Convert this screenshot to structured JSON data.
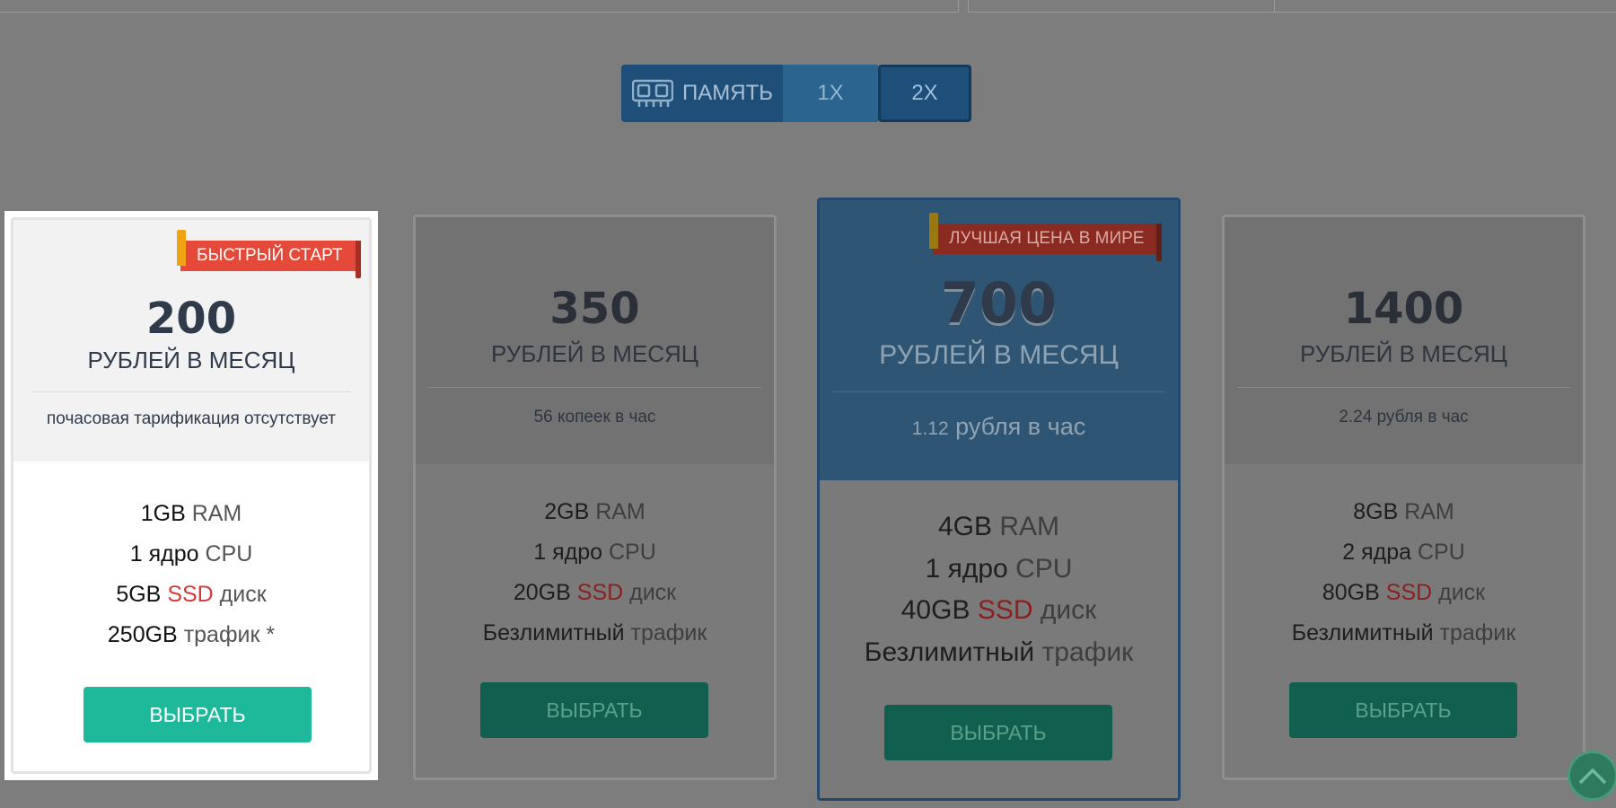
{
  "memory_toggle": {
    "label": "ПАМЯТЬ",
    "options": [
      "1X",
      "2X"
    ],
    "selected": "2X"
  },
  "plans": [
    {
      "price": "200",
      "unit": "РУБЛЕЙ В МЕСЯЦ",
      "hourly": "почасовая тарификация отсутствует",
      "ribbon": "БЫСТРЫЙ СТАРТ",
      "ram_value": "1GB",
      "ram_label": "RAM",
      "cpu_value": "1 ядро",
      "cpu_label": "CPU",
      "disk_value": "5GB",
      "disk_ssd": "SSD",
      "disk_label": "диск",
      "traffic_value": "250GB",
      "traffic_label": "трафик *",
      "button": "ВЫБРАТЬ"
    },
    {
      "price": "350",
      "unit": "РУБЛЕЙ В МЕСЯЦ",
      "hourly": "56 копеек в час",
      "ram_value": "2GB",
      "ram_label": "RAM",
      "cpu_value": "1 ядро",
      "cpu_label": "CPU",
      "disk_value": "20GB",
      "disk_ssd": "SSD",
      "disk_label": "диск",
      "traffic_value": "Безлимитный",
      "traffic_label": "трафик",
      "button": "ВЫБРАТЬ"
    },
    {
      "price": "700",
      "unit": "РУБЛЕЙ В МЕСЯЦ",
      "hourly_num": "1.12",
      "hourly_text": "рубля в час",
      "ribbon": "ЛУЧШАЯ ЦЕНА В МИРЕ",
      "ram_value": "4GB",
      "ram_label": "RAM",
      "cpu_value": "1 ядро",
      "cpu_label": "CPU",
      "disk_value": "40GB",
      "disk_ssd": "SSD",
      "disk_label": "диск",
      "traffic_value": "Безлимитный",
      "traffic_label": "трафик",
      "button": "ВЫБРАТЬ"
    },
    {
      "price": "1400",
      "unit": "РУБЛЕЙ В МЕСЯЦ",
      "hourly": "2.24 рубля в час",
      "ram_value": "8GB",
      "ram_label": "RAM",
      "cpu_value": "2 ядра",
      "cpu_label": "CPU",
      "disk_value": "80GB",
      "disk_ssd": "SSD",
      "disk_label": "диск",
      "traffic_value": "Безлимитный",
      "traffic_label": "трафик",
      "button": "ВЫБРАТЬ"
    }
  ],
  "icons": {
    "memory": "ram-chip-icon",
    "scroll_top": "chevron-up-icon"
  }
}
